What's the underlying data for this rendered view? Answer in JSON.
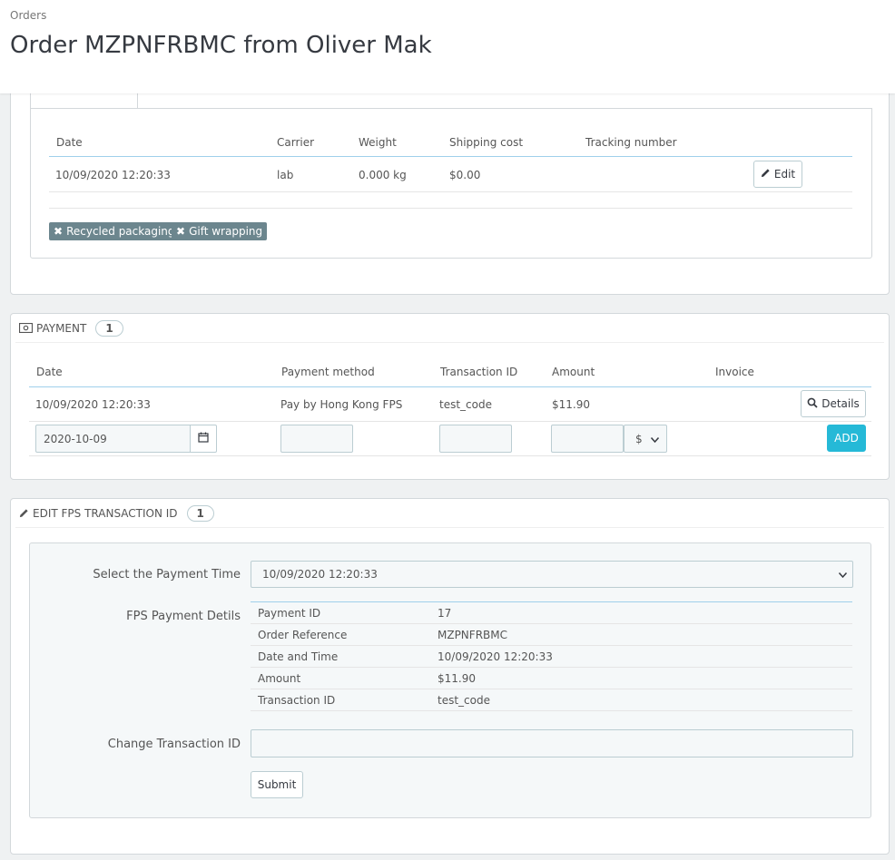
{
  "header": {
    "breadcrumb": "Orders",
    "title": "Order MZPNFRBMC from Oliver Mak"
  },
  "shipping": {
    "columns": [
      "Date",
      "Carrier",
      "Weight",
      "Shipping cost",
      "Tracking number"
    ],
    "row": {
      "date": "10/09/2020 12:20:33",
      "carrier": "lab",
      "weight": "0.000 kg",
      "shipping_cost": "$0.00",
      "tracking_number": ""
    },
    "edit_label": "Edit",
    "tags": [
      "Recycled packaging",
      "Gift wrapping"
    ]
  },
  "payment": {
    "title": "PAYMENT",
    "count": "1",
    "columns": [
      "Date",
      "Payment method",
      "Transaction ID",
      "Amount",
      "Invoice"
    ],
    "row": {
      "date": "10/09/2020 12:20:33",
      "method": "Pay by Hong Kong FPS",
      "transaction_id": "test_code",
      "amount": "$11.90"
    },
    "details_label": "Details",
    "new_date_value": "2020-10-09",
    "currency_selected": "$",
    "add_label": "ADD"
  },
  "fps": {
    "title": "EDIT FPS TRANSACTION ID",
    "count": "1",
    "select_label": "Select the Payment Time",
    "select_value": "10/09/2020 12:20:33",
    "details_label": "FPS Payment Detils",
    "details": [
      {
        "key": "Payment ID",
        "value": "17"
      },
      {
        "key": "Order Reference",
        "value": "MZPNFRBMC"
      },
      {
        "key": "Date and Time",
        "value": "10/09/2020 12:20:33"
      },
      {
        "key": "Amount",
        "value": "$11.90"
      },
      {
        "key": "Transaction ID",
        "value": "test_code"
      }
    ],
    "change_label": "Change Transaction ID",
    "change_value": "",
    "submit_label": "Submit"
  },
  "colors": {
    "accent": "#25b9d7",
    "tag_bg": "#6c868e",
    "page_bg": "#eff1f2"
  }
}
